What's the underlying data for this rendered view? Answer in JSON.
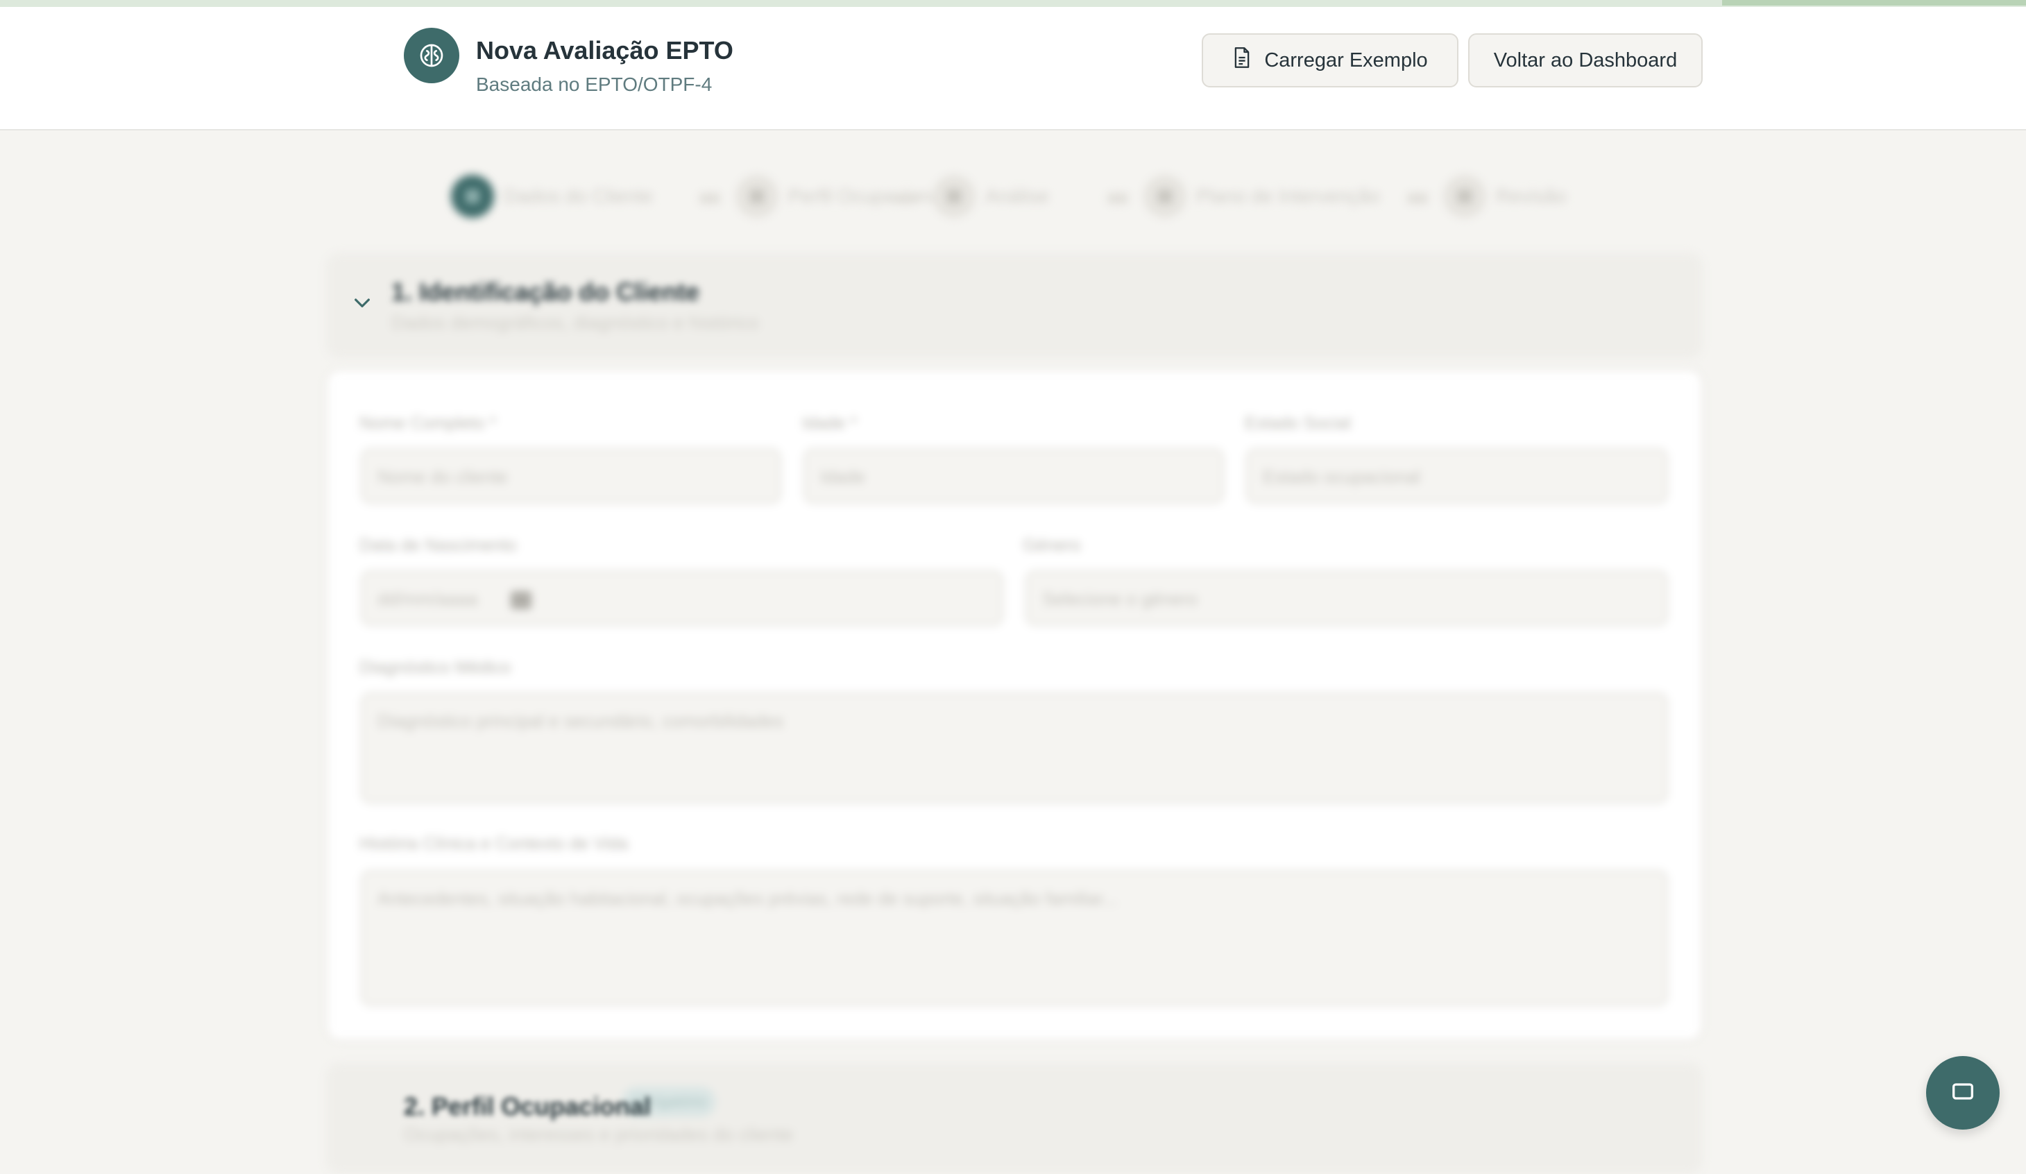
{
  "header": {
    "title": "Nova Avaliação EPTO",
    "subtitle": "Baseada no EPTO/OTPF-4",
    "load_example_label": "Carregar Exemplo",
    "back_dashboard_label": "Voltar ao Dashboard"
  },
  "stepper": {
    "steps": [
      {
        "label": "Dados do Cliente",
        "active": true
      },
      {
        "label": "Perfil Ocupacional",
        "active": false
      },
      {
        "label": "Análise",
        "active": false
      },
      {
        "label": "Plano de Intervenção",
        "active": false
      },
      {
        "label": "Revisão",
        "active": false
      }
    ]
  },
  "section1": {
    "number": "1.",
    "title": "Identificação do Cliente",
    "subtitle": "Dados demográficos, diagnóstico e histórico",
    "fields": {
      "nome_label": "Nome Completo *",
      "nome_placeholder": "Nome do cliente",
      "idade_label": "Idade *",
      "idade_placeholder": "Idade",
      "estado_label": "Estado Social",
      "estado_placeholder": "Estado ocupacional",
      "data_label": "Data de Nascimento",
      "data_placeholder": "dd/mm/aaaa",
      "genero_label": "Género",
      "genero_placeholder": "Selecione o género",
      "diagnostico_label": "Diagnóstico Médico",
      "diagnostico_placeholder": "Diagnóstico principal e secundário, comorbilidades",
      "historia_label": "História Clínica e Contexto de Vida",
      "historia_placeholder": "Antecedentes, situação habitacional, ocupações prévias, rede de suporte, situação familiar..."
    }
  },
  "section2": {
    "number": "2.",
    "title": "Perfil Ocupacional",
    "badge": "Obrigatório",
    "subtitle": "Ocupações, interesses e prioridades do cliente"
  },
  "icons": {
    "logo": "brain-icon",
    "example": "document-icon",
    "fab": "chat-icon"
  },
  "colors": {
    "accent": "#3e6b6a",
    "background": "#f5f4f1"
  }
}
